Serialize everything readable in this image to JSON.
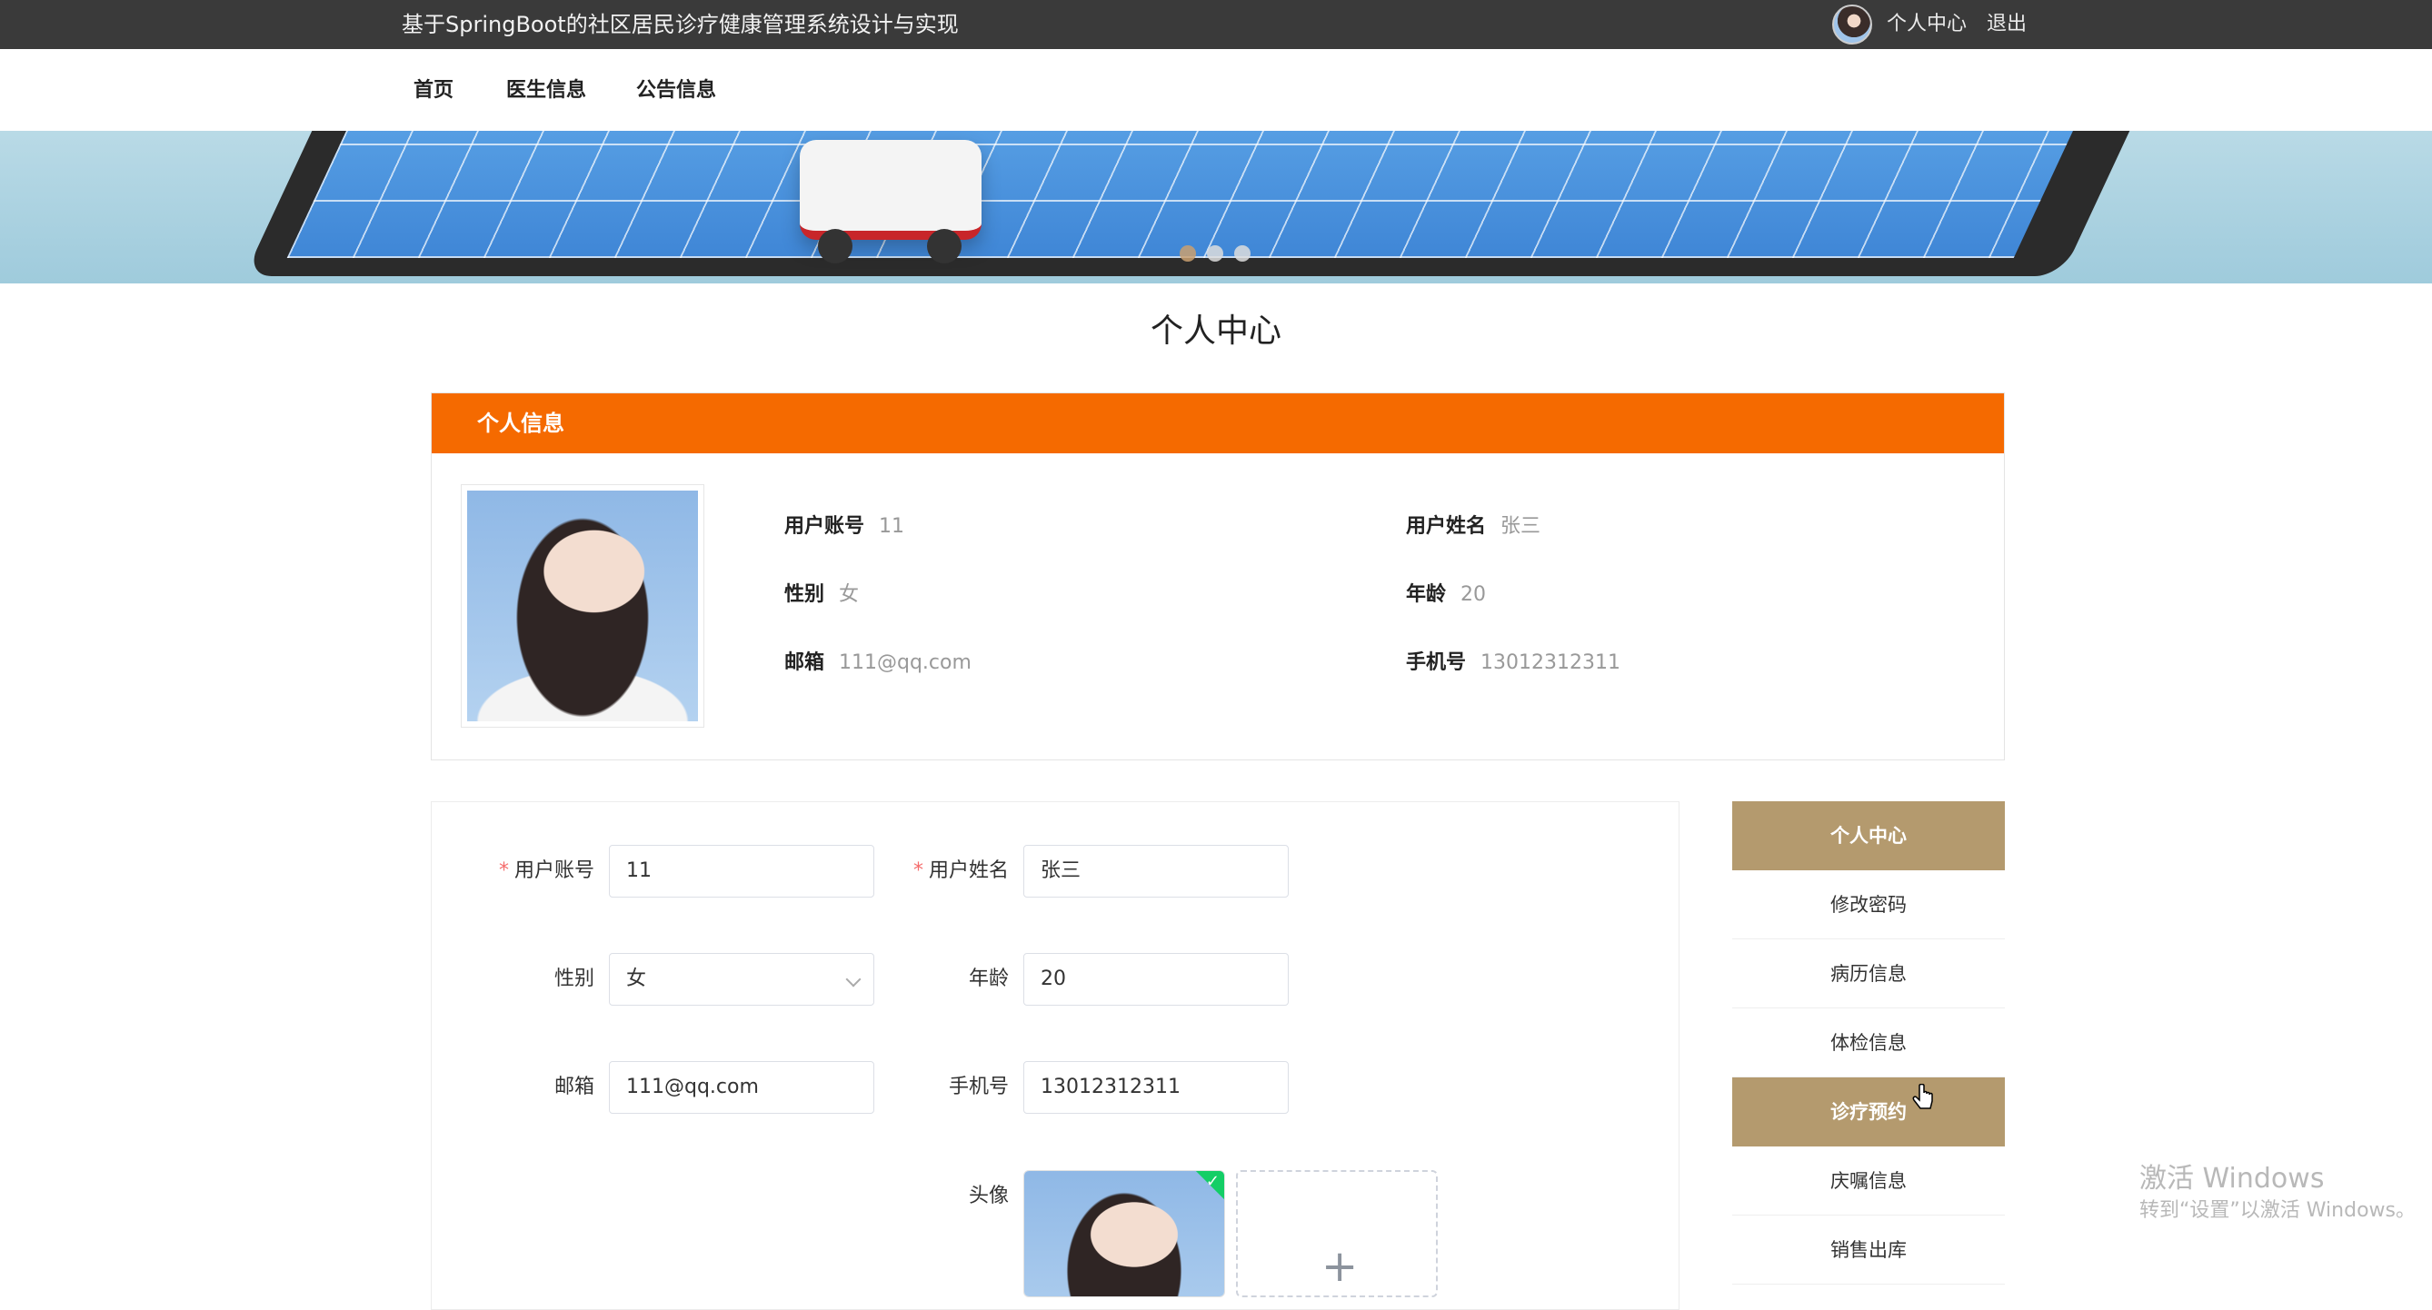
{
  "header": {
    "site_title": "基于SpringBoot的社区居民诊疗健康管理系统设计与实现",
    "user_center_link": "个人中心",
    "logout_link": "退出"
  },
  "nav": {
    "items": [
      {
        "label": "首页"
      },
      {
        "label": "医生信息"
      },
      {
        "label": "公告信息"
      }
    ]
  },
  "banner": {
    "slide_count": 3,
    "active_index": 0
  },
  "page": {
    "title": "个人中心"
  },
  "info_card": {
    "header": "个人信息",
    "fields": {
      "account_label": "用户账号",
      "account_value": "11",
      "name_label": "用户姓名",
      "name_value": "张三",
      "gender_label": "性别",
      "gender_value": "女",
      "age_label": "年龄",
      "age_value": "20",
      "email_label": "邮箱",
      "email_value": "111@qq.com",
      "phone_label": "手机号",
      "phone_value": "13012312311"
    }
  },
  "form": {
    "required_mark": "*",
    "account_label": "用户账号",
    "account_value": "11",
    "name_label": "用户姓名",
    "name_value": "张三",
    "gender_label": "性别",
    "gender_value": "女",
    "age_label": "年龄",
    "age_value": "20",
    "email_label": "邮箱",
    "email_value": "111@qq.com",
    "phone_label": "手机号",
    "phone_value": "13012312311",
    "avatar_label": "头像",
    "upload_plus": "+",
    "upload_check": "✓"
  },
  "side_menu": {
    "items": [
      {
        "label": "个人中心",
        "active": true
      },
      {
        "label": "修改密码",
        "active": false
      },
      {
        "label": "病历信息",
        "active": false
      },
      {
        "label": "体检信息",
        "active": false
      },
      {
        "label": "诊疗预约",
        "active": true
      },
      {
        "label": "庆嘱信息",
        "active": false
      },
      {
        "label": "销售出库",
        "active": false
      }
    ]
  },
  "watermark": {
    "line1": "激活 Windows",
    "line2": "转到“设置”以激活 Windows。"
  },
  "colors": {
    "topbar": "#3a3a3a",
    "info_header": "#f56a00",
    "menu_active": "#b49a6e",
    "required": "#f56c6c",
    "upload_success": "#13ce66"
  }
}
